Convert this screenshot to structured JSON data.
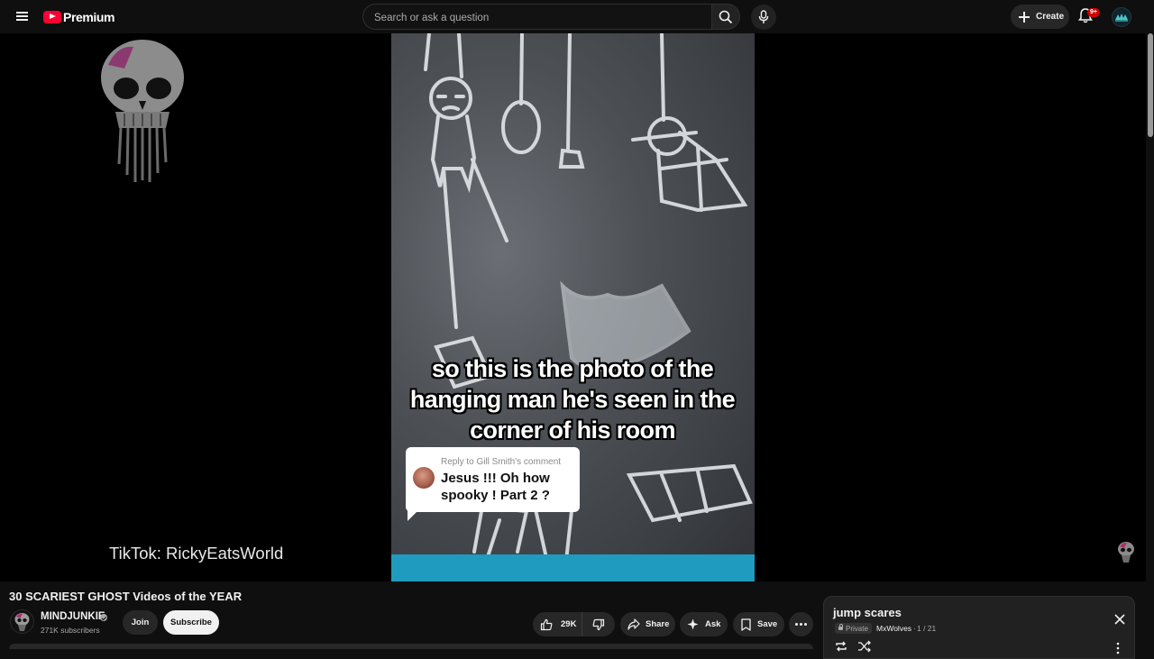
{
  "header": {
    "brand": "Premium",
    "search_placeholder": "Search or ask a question",
    "create_label": "Create",
    "notifications_badge": "9+"
  },
  "player": {
    "caption": "so this is the photo of the hanging man he's seen in the corner of his room",
    "reply_header": "Reply to Gill Smith's comment",
    "reply_text": "Jesus !!! Oh how spooky ! Part 2 ?",
    "overlay_text": "TikTok: RickyEatsWorld"
  },
  "video": {
    "title": "30 SCARIEST GHOST Videos of the YEAR",
    "channel": "MINDJUNKIE",
    "subscribers": "271K subscribers",
    "join_label": "Join",
    "subscribe_label": "Subscribe",
    "likes": "29K",
    "share_label": "Share",
    "ask_label": "Ask",
    "save_label": "Save"
  },
  "playlist": {
    "title": "jump scares",
    "privacy": "Private",
    "owner": "MxWolves",
    "separator": "·",
    "position": "1 / 21"
  },
  "colors": {
    "background": "#0f0f0f",
    "brand_red": "#ff0033",
    "badge_red": "#cc0000",
    "pill_bg": "#272727",
    "subscribe_bg": "#f1f1f1"
  },
  "icons": [
    "menu-icon",
    "youtube-logo-icon",
    "search-icon",
    "mic-icon",
    "plus-icon",
    "bell-icon",
    "like-icon",
    "dislike-icon",
    "share-icon",
    "sparkle-icon",
    "bookmark-icon",
    "more-icon",
    "close-icon",
    "loop-icon",
    "shuffle-icon",
    "kebab-icon",
    "lock-icon",
    "verified-icon"
  ]
}
